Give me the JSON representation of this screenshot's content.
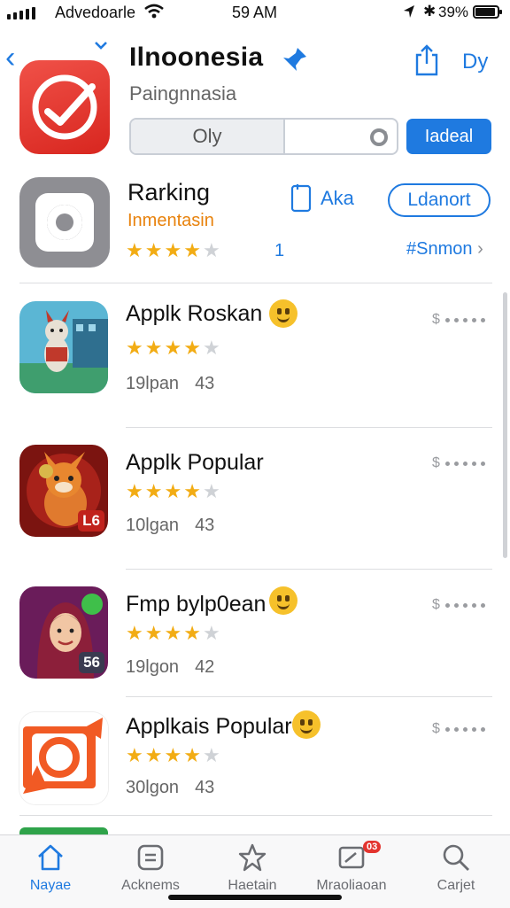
{
  "status_bar": {
    "carrier": "Advedoarle",
    "time": "59 AM",
    "battery": "39%"
  },
  "header": {
    "title": "Ilnoonesia",
    "subtitle": "Paingnnasia",
    "right_label": "Dy",
    "segment_label": "Oly",
    "primary_button": "Iadeal"
  },
  "ranking": {
    "title": "Rarking",
    "subtitle": "Inmentasin",
    "rating": 4,
    "count": "1",
    "ask_label": "Aka",
    "outline_button": "Ldanort",
    "link_label": "#Snmon"
  },
  "apps": [
    {
      "name": "Applk Roskan",
      "size": "19lpan",
      "num": "43",
      "rating": 4,
      "emoji": true,
      "art": "fox-city"
    },
    {
      "name": "Applk Popular",
      "size": "10lgan",
      "num": "43",
      "rating": 4,
      "emoji": false,
      "art": "fox-red",
      "badge": "L6"
    },
    {
      "name": "Fmp bylp0ean",
      "size": "19lgon",
      "num": "42",
      "rating": 3.5,
      "emoji": true,
      "art": "girl",
      "badge": "56"
    },
    {
      "name": "Applkais Popular",
      "size": "30lgon",
      "num": "43",
      "rating": 3.5,
      "emoji": true,
      "art": "orange-frame"
    }
  ],
  "tabs": [
    {
      "label": "Nayae",
      "icon": "home-icon",
      "active": true
    },
    {
      "label": "Acknems",
      "icon": "apps-icon",
      "active": false
    },
    {
      "label": "Haetain",
      "icon": "star-icon",
      "active": false
    },
    {
      "label": "Mraoliaoan",
      "icon": "updates-icon",
      "active": false,
      "badge": "03"
    },
    {
      "label": "Carjet",
      "icon": "search-icon",
      "active": false
    }
  ],
  "colors": {
    "accent": "#1f7ae0",
    "star": "#f2ac14",
    "orange_text": "#e8820c",
    "main_icon": "#e3342f"
  }
}
